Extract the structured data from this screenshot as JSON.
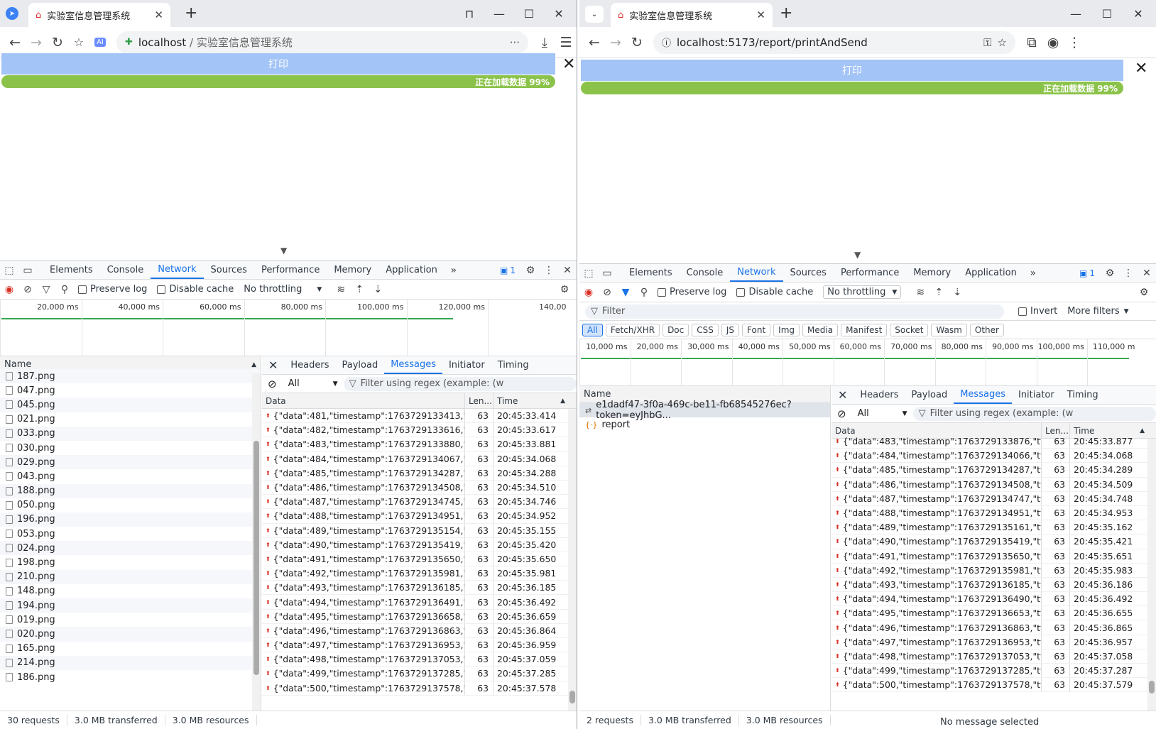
{
  "left": {
    "tab_title": "实验室信息管理系统",
    "url_host": "localhost",
    "url_sep": " / ",
    "url_title": "实验室信息管理系统",
    "print_label": "打印",
    "progress_text": "正在加载数据 99%",
    "progress_value": 0.99,
    "devtools_tabs": [
      "Elements",
      "Console",
      "Network",
      "Sources",
      "Performance",
      "Memory",
      "Application"
    ],
    "active_tab": "Network",
    "badge_count": "1",
    "preserve_log": "Preserve log",
    "disable_cache": "Disable cache",
    "throttling": "No throttling",
    "timeline_ticks": [
      "20,000 ms",
      "40,000 ms",
      "60,000 ms",
      "80,000 ms",
      "100,000 ms",
      "120,000 ms",
      "140,00"
    ],
    "name_header": "Name",
    "files": [
      "187.png",
      "047.png",
      "045.png",
      "021.png",
      "033.png",
      "030.png",
      "029.png",
      "043.png",
      "188.png",
      "050.png",
      "196.png",
      "053.png",
      "024.png",
      "198.png",
      "210.png",
      "148.png",
      "194.png",
      "019.png",
      "020.png",
      "165.png",
      "214.png",
      "186.png"
    ],
    "msg_tabs": [
      "Headers",
      "Payload",
      "Messages",
      "Initiator",
      "Timing"
    ],
    "active_msg_tab": "Messages",
    "filter_all": "All",
    "filter_placeholder": "Filter using regex (example: (w",
    "col_data": "Data",
    "col_len": "Len...",
    "col_time": "Time",
    "messages": [
      [
        "{\"data\":481,\"timestamp\":1763729133413,\"type...",
        "63",
        "20:45:33.414"
      ],
      [
        "{\"data\":482,\"timestamp\":1763729133616,\"type...",
        "63",
        "20:45:33.617"
      ],
      [
        "{\"data\":483,\"timestamp\":1763729133880,\"type...",
        "63",
        "20:45:33.881"
      ],
      [
        "{\"data\":484,\"timestamp\":1763729134067,\"type...",
        "63",
        "20:45:34.068"
      ],
      [
        "{\"data\":485,\"timestamp\":1763729134287,\"type...",
        "63",
        "20:45:34.288"
      ],
      [
        "{\"data\":486,\"timestamp\":1763729134508,\"type...",
        "63",
        "20:45:34.510"
      ],
      [
        "{\"data\":487,\"timestamp\":1763729134745,\"type...",
        "63",
        "20:45:34.746"
      ],
      [
        "{\"data\":488,\"timestamp\":1763729134951,\"type...",
        "63",
        "20:45:34.952"
      ],
      [
        "{\"data\":489,\"timestamp\":1763729135154,\"type...",
        "63",
        "20:45:35.155"
      ],
      [
        "{\"data\":490,\"timestamp\":1763729135419,\"type...",
        "63",
        "20:45:35.420"
      ],
      [
        "{\"data\":491,\"timestamp\":1763729135650,\"type...",
        "63",
        "20:45:35.650"
      ],
      [
        "{\"data\":492,\"timestamp\":1763729135981,\"type...",
        "63",
        "20:45:35.981"
      ],
      [
        "{\"data\":493,\"timestamp\":1763729136185,\"type...",
        "63",
        "20:45:36.185"
      ],
      [
        "{\"data\":494,\"timestamp\":1763729136491,\"type...",
        "63",
        "20:45:36.492"
      ],
      [
        "{\"data\":495,\"timestamp\":1763729136658,\"type...",
        "63",
        "20:45:36.659"
      ],
      [
        "{\"data\":496,\"timestamp\":1763729136863,\"type...",
        "63",
        "20:45:36.864"
      ],
      [
        "{\"data\":497,\"timestamp\":1763729136953,\"type...",
        "63",
        "20:45:36.959"
      ],
      [
        "{\"data\":498,\"timestamp\":1763729137053,\"type...",
        "63",
        "20:45:37.059"
      ],
      [
        "{\"data\":499,\"timestamp\":1763729137285,\"type...",
        "63",
        "20:45:37.285"
      ],
      [
        "{\"data\":500,\"timestamp\":1763729137578,\"type...",
        "63",
        "20:45:37.578"
      ]
    ],
    "status": [
      "30 requests",
      "3.0 MB transferred",
      "3.0 MB resources"
    ]
  },
  "right": {
    "tab_title": "实验室信息管理系统",
    "url": "localhost:5173/report/printAndSend",
    "print_label": "打印",
    "progress_text": "正在加载数据 99%",
    "progress_value": 0.99,
    "devtools_tabs": [
      "Elements",
      "Console",
      "Network",
      "Sources",
      "Performance",
      "Memory",
      "Application"
    ],
    "active_tab": "Network",
    "badge_count": "1",
    "preserve_log": "Preserve log",
    "disable_cache": "Disable cache",
    "throttling": "No throttling",
    "filter_label": "Filter",
    "invert": "Invert",
    "more_filters": "More filters",
    "chips": [
      "All",
      "Fetch/XHR",
      "Doc",
      "CSS",
      "JS",
      "Font",
      "Img",
      "Media",
      "Manifest",
      "Socket",
      "Wasm",
      "Other"
    ],
    "timeline_ticks": [
      "10,000 ms",
      "20,000 ms",
      "30,000 ms",
      "40,000 ms",
      "50,000 ms",
      "60,000 ms",
      "70,000 ms",
      "80,000 ms",
      "90,000 ms",
      "100,000 ms",
      "110,000 m"
    ],
    "name_header": "Name",
    "requests": [
      {
        "name": "e1dadf47-3f0a-469c-be11-fb68545276ec?token=eyJhbG...",
        "icon": "websocket-icon"
      },
      {
        "name": "report",
        "icon": "xhr-icon"
      }
    ],
    "msg_tabs": [
      "Headers",
      "Payload",
      "Messages",
      "Initiator",
      "Timing"
    ],
    "active_msg_tab": "Messages",
    "filter_all": "All",
    "filter_placeholder": "Filter using regex (example: (w",
    "col_data": "Data",
    "col_len": "Len...",
    "col_time": "Time",
    "messages": [
      [
        "{\"data\":483,\"timestamp\":1763729133876,\"type\":...",
        "63",
        "20:45:33.877"
      ],
      [
        "{\"data\":484,\"timestamp\":1763729134066,\"type\":...",
        "63",
        "20:45:34.068"
      ],
      [
        "{\"data\":485,\"timestamp\":1763729134287,\"type\":...",
        "63",
        "20:45:34.289"
      ],
      [
        "{\"data\":486,\"timestamp\":1763729134508,\"type\":...",
        "63",
        "20:45:34.509"
      ],
      [
        "{\"data\":487,\"timestamp\":1763729134747,\"type\":...",
        "63",
        "20:45:34.748"
      ],
      [
        "{\"data\":488,\"timestamp\":1763729134951,\"type\":...",
        "63",
        "20:45:34.953"
      ],
      [
        "{\"data\":489,\"timestamp\":1763729135161,\"type\":...",
        "63",
        "20:45:35.162"
      ],
      [
        "{\"data\":490,\"timestamp\":1763729135419,\"type\":...",
        "63",
        "20:45:35.421"
      ],
      [
        "{\"data\":491,\"timestamp\":1763729135650,\"type\":...",
        "63",
        "20:45:35.651"
      ],
      [
        "{\"data\":492,\"timestamp\":1763729135981,\"type\":...",
        "63",
        "20:45:35.983"
      ],
      [
        "{\"data\":493,\"timestamp\":1763729136185,\"type\":...",
        "63",
        "20:45:36.186"
      ],
      [
        "{\"data\":494,\"timestamp\":1763729136490,\"type\":...",
        "63",
        "20:45:36.492"
      ],
      [
        "{\"data\":495,\"timestamp\":1763729136653,\"type\":...",
        "63",
        "20:45:36.655"
      ],
      [
        "{\"data\":496,\"timestamp\":1763729136863,\"type\":...",
        "63",
        "20:45:36.865"
      ],
      [
        "{\"data\":497,\"timestamp\":1763729136953,\"type\":...",
        "63",
        "20:45:36.957"
      ],
      [
        "{\"data\":498,\"timestamp\":1763729137053,\"type\":...",
        "63",
        "20:45:37.058"
      ],
      [
        "{\"data\":499,\"timestamp\":1763729137285,\"type\":...",
        "63",
        "20:45:37.287"
      ],
      [
        "{\"data\":500,\"timestamp\":1763729137578,\"type\":...",
        "63",
        "20:45:37.579"
      ]
    ],
    "status": [
      "2 requests",
      "3.0 MB transferred",
      "3.0 MB resources"
    ],
    "no_message": "No message selected"
  }
}
